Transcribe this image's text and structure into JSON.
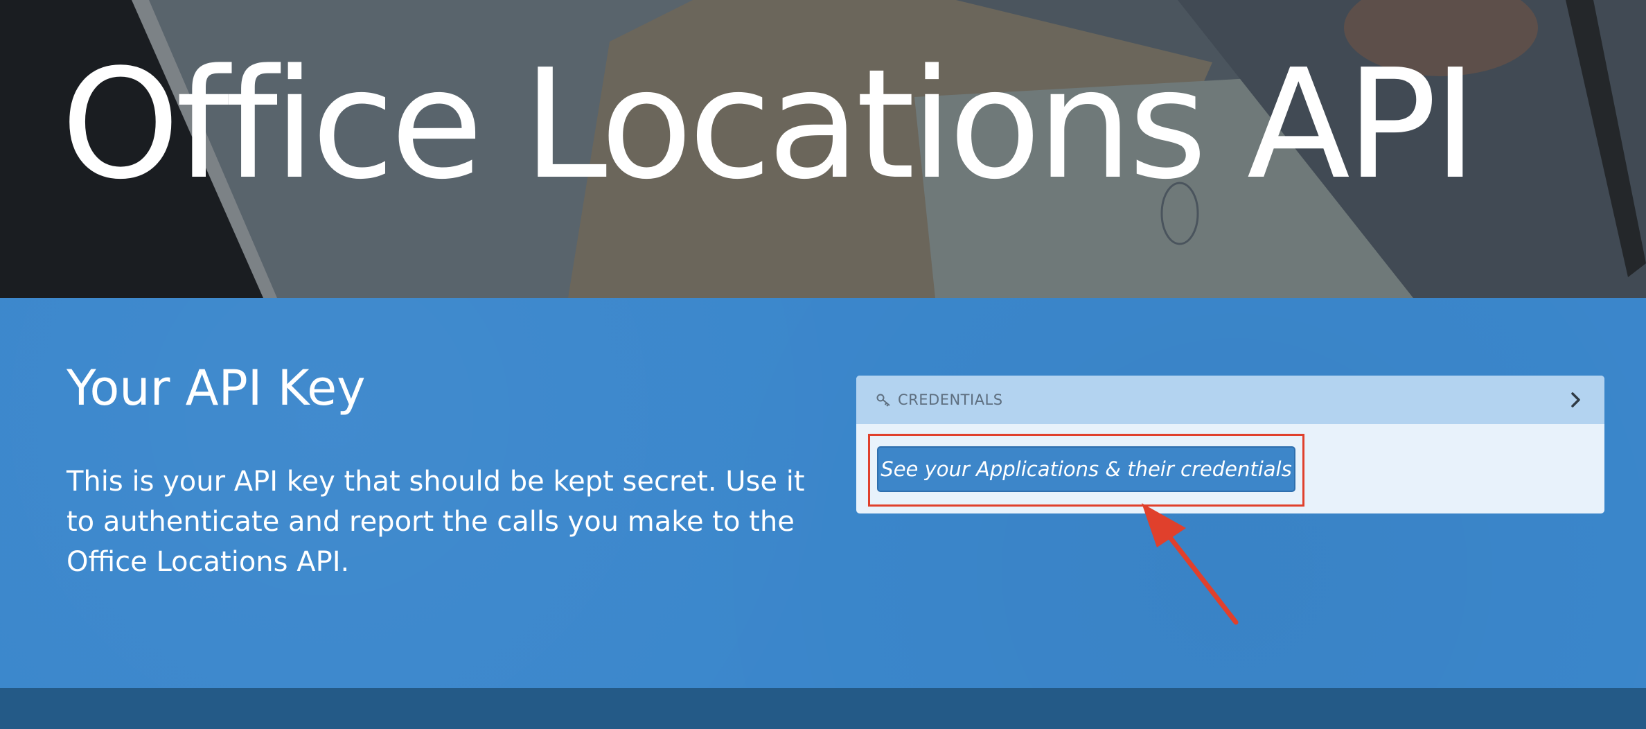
{
  "hero": {
    "title": "Office Locations API"
  },
  "api_key_section": {
    "heading": "Your API Key",
    "description": "This is your API key that should be kept secret. Use it to authenticate and report the calls you make to the Office Locations API."
  },
  "credentials_card": {
    "header_label": "CREDENTIALS",
    "header_icon": "key-icon",
    "expand_icon": "chevron-right-icon",
    "button_label": "See your Applications & their credentials"
  },
  "annotation": {
    "highlight_color": "#e0402c",
    "arrow_color": "#e0402c"
  },
  "colors": {
    "section_blue": "#3b87cc",
    "card_header": "#b3d3f0",
    "card_body": "#e8f2fb",
    "button_blue": "#3d86c9",
    "bottom_band": "#245a87"
  }
}
